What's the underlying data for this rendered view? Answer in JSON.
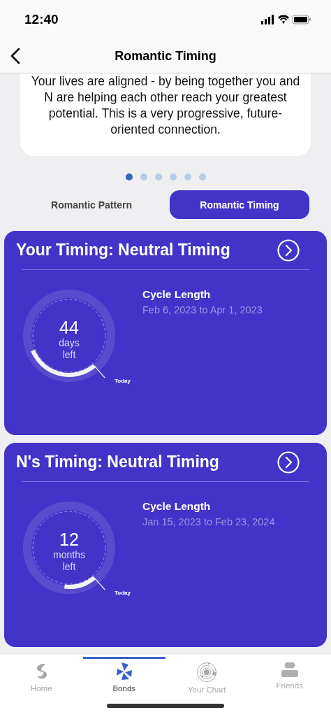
{
  "status_bar": {
    "time": "12:40"
  },
  "nav": {
    "title": "Romantic Timing"
  },
  "summary": {
    "text": "Your lives are aligned - by being together you and N are helping each other reach your greatest potential. This is a very progressive, future-oriented connection."
  },
  "pager": [
    {
      "selected": true
    },
    {
      "selected": false
    },
    {
      "selected": false
    },
    {
      "selected": false
    },
    {
      "selected": false
    },
    {
      "selected": false
    }
  ],
  "segments": [
    {
      "label": "Romantic Pattern",
      "selected": false
    },
    {
      "label": "Romantic Timing",
      "selected": true
    }
  ],
  "timings": [
    {
      "title": "Your Timing: Neutral Timing",
      "count": "44",
      "unit": "days",
      "suffix": "left",
      "marker": "Today",
      "detail_label": "Cycle Length",
      "detail_value": "Feb 6, 2023 to Apr 1, 2023"
    },
    {
      "title": "N's Timing: Neutral Timing",
      "count": "12",
      "unit": "months",
      "suffix": "left",
      "marker": "Today",
      "detail_label": "Cycle Length",
      "detail_value": "Jan 15, 2023 to Feb 23, 2024"
    }
  ],
  "tab_bar": [
    {
      "label": "Home",
      "kind": "home",
      "selected": false
    },
    {
      "label": "Bonds",
      "kind": "bonds",
      "selected": true
    },
    {
      "label": "Your Chart",
      "kind": "chart",
      "selected": false
    },
    {
      "label": "Friends",
      "kind": "friends",
      "selected": false
    }
  ]
}
